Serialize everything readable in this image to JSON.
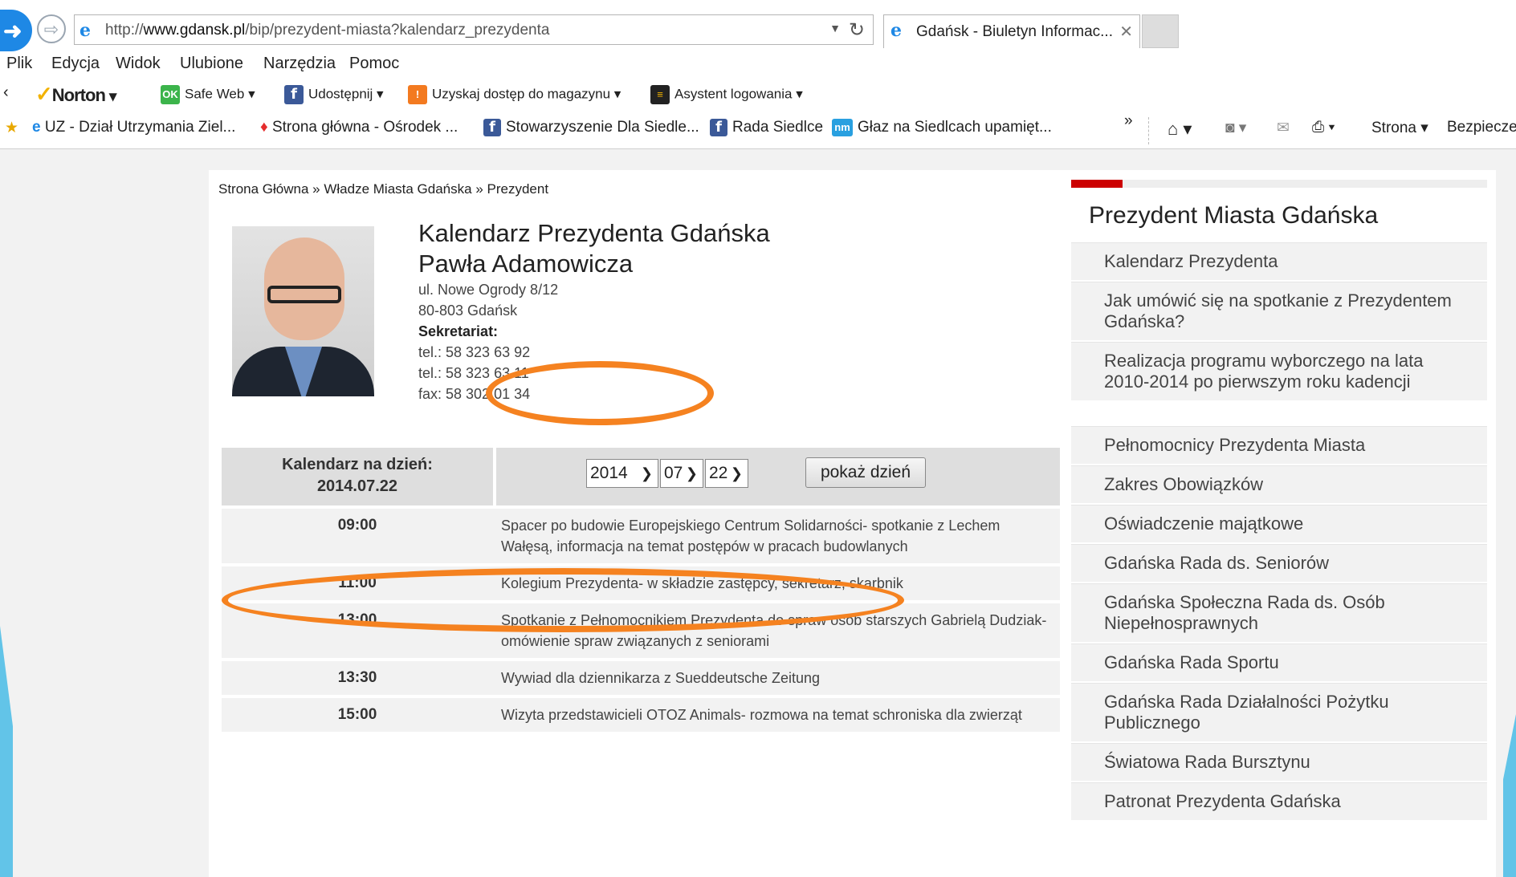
{
  "browser": {
    "url_prefix": "http://",
    "url_domain": "www.gdansk.pl",
    "url_path": "/bip/prezydent-miasta?kalendarz_prezydenta",
    "tab_title": "Gdańsk - Biuletyn Informac...",
    "menu": [
      "Plik",
      "Edycja",
      "Widok",
      "Ulubione",
      "Narzędzia",
      "Pomoc"
    ],
    "toolbar": {
      "norton": "Norton",
      "safe_web": "Safe Web",
      "share": "Udostępnij",
      "magazine": "Uzyskaj dostęp do magazynu",
      "login": "Asystent logowania"
    },
    "favorites": [
      "UZ - Dział Utrzymania Ziel...",
      "Strona główna - Ośrodek ...",
      "Stowarzyszenie Dla Siedle...",
      "Rada Siedlce",
      "Głaz na Siedlcach upamięt..."
    ],
    "fav_more": "»",
    "right_tools": {
      "page": "Strona",
      "safety": "Bezpiecze"
    }
  },
  "page": {
    "breadcrumb": "Strona Główna » Władze Miasta Gdańska » Prezydent",
    "title_line1": "Kalendarz Prezydenta Gdańska",
    "title_line2": "Pawła Adamowicza",
    "address": {
      "street": "ul. Nowe Ogrody 8/12",
      "city": "80-803 Gdańsk",
      "secretariat": "Sekretariat:",
      "tel1": "tel.: 58 323 63 92",
      "tel2": "tel.: 58 323 63 11",
      "fax": "fax: 58 302 01 34"
    },
    "calendar": {
      "label_line1": "Kalendarz na dzień:",
      "label_line2": "2014.07.22",
      "year": "2014",
      "month": "07",
      "day": "22",
      "show_button": "pokaż dzień",
      "events": [
        {
          "time": "09:00",
          "text": "Spacer po budowie Europejskiego Centrum Solidarności- spotkanie z Lechem Wałęsą, informacja na temat postępów w pracach budowlanych"
        },
        {
          "time": "11:00",
          "text": "Kolegium Prezydenta- w składzie zastępcy, sekretarz, skarbnik"
        },
        {
          "time": "13:00",
          "text": "Spotkanie z Pełnomocnikiem Prezydenta do spraw osób starszych Gabrielą Dudziak- omówienie spraw związanych z seniorami"
        },
        {
          "time": "13:30",
          "text": "Wywiad dla dziennikarza z Sueddeutsche Zeitung"
        },
        {
          "time": "15:00",
          "text": "Wizyta przedstawicieli OTOZ Animals- rozmowa na temat schroniska dla zwierząt"
        }
      ]
    }
  },
  "sidebar": {
    "title": "Prezydent Miasta Gdańska",
    "group1": [
      "Kalendarz Prezydenta",
      "Jak umówić się na spotkanie z Prezydentem Gdańska?",
      "Realizacja programu wyborczego na lata 2010-2014 po pierwszym roku kadencji"
    ],
    "group2": [
      "Pełnomocnicy Prezydenta Miasta",
      "Zakres Obowiązków",
      "Oświadczenie majątkowe",
      "Gdańska Rada ds. Seniorów",
      "Gdańska Społeczna Rada ds. Osób Niepełnosprawnych",
      "Gdańska Rada Sportu",
      "Gdańska Rada Działalności Pożytku Publicznego",
      "Światowa Rada Bursztynu",
      "Patronat Prezydenta Gdańska"
    ]
  },
  "colors": {
    "accent": "#cc0000",
    "highlight": "#f58220",
    "ie_blue": "#1e88e5"
  }
}
